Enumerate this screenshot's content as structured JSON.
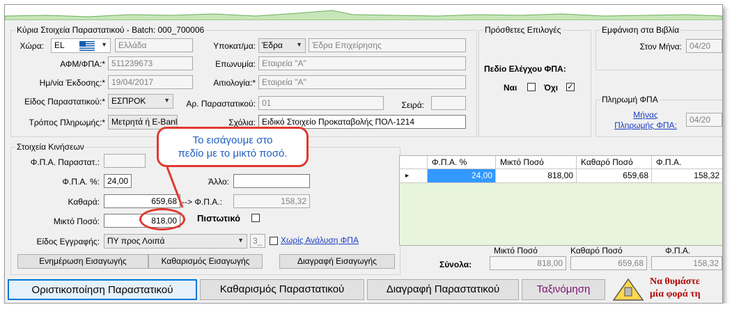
{
  "colors": {
    "accent_red": "#e03a2f",
    "callout_text": "#1f5fc0",
    "link": "#1a3dc1",
    "grid_selected": "#3399ff",
    "grid_background": "#e8f5dc",
    "warning_text": "#b40000",
    "sort_button_text": "#7a1070"
  },
  "main_group": {
    "title": "Κύρια Στοιχεία Παραστατικού - Batch: 000_700006",
    "country_label": "Χώρα:",
    "country_code": "EL",
    "country_name": "Ελλάδα",
    "afm_label": "ΑΦΜ/ΦΠΑ:*",
    "afm_value": "511239673",
    "date_label": "Ημ/νία Έκδοσης:*",
    "date_value": "19/04/2017",
    "doctype_label": "Είδος Παραστατικού:*",
    "doctype_value": "ΕΣΠΡΟΚ",
    "payment_label": "Τρόπος Πληρωμής:*",
    "payment_value": "Μετρητά ή E-Banl",
    "branch_label": "Υποκατ/μα:",
    "branch_value": "Έδρα",
    "branch_desc": "Έδρα Επιχείρησης",
    "name_label": "Επωνυμία:",
    "name_value": "Εταιρεία \"Α\"",
    "reason_label": "Αιτιολογία:*",
    "reason_value": "Εταιρεία \"Α\"",
    "docnum_label": "Αρ. Παραστατικού:",
    "docnum_value": "01",
    "series_label": "Σειρά:",
    "comments_label": "Σχόλια:",
    "comments_value": "Ειδικό Στοιχείο Προκαταβολής ΠΟΛ-1214"
  },
  "options_group": {
    "title": "Πρόσθετες Επιλογές",
    "vat_check_label": "Πεδίο Ελέγχου ΦΠΑ:",
    "yes_label": "Ναι",
    "no_label": "Όχι",
    "yes_checked": false,
    "no_checked": true
  },
  "books_group": {
    "title": "Εμφάνιση στα Βιβλία",
    "month_label": "Στον Μήνα:",
    "month_value": "04/20"
  },
  "vat_payment_group": {
    "title": "Πληρωμή ΦΠΑ",
    "link_line1": "Μήνας",
    "link_line2": "Πληρωμής ΦΠΑ:",
    "value": "04/20"
  },
  "movements_group": {
    "title": "Στοιχεία Κινήσεων",
    "vat_doc_label": "Φ.Π.Α. Παραστατ.:",
    "vat_pct_label": "Φ.Π.Α. %:",
    "vat_pct_value": "24,00",
    "net_label": "Καθαρά:",
    "net_value": "659,68",
    "vat_arrow_label": "--> Φ.Π.Α.:",
    "vat_amount": "158,32",
    "other_label": "Άλλο:",
    "gross_label": "Μικτό Ποσό:",
    "gross_value": "818,00",
    "credit_label": "Πιστωτικό",
    "entry_type_label": "Είδος Εγγραφής:",
    "entry_type_value": "ΠΥ προς Λοιπά",
    "entry_type_code": "3_",
    "no_vat_label": "Χωρίς Ανάλυση ΦΠΑ"
  },
  "callout": {
    "line1": "Το εισάγουμε στο",
    "line2": "πεδίο με το μικτό ποσό."
  },
  "grid": {
    "columns": [
      "Φ.Π.Α. %",
      "Μικτό Ποσό",
      "Καθαρό Ποσό",
      "Φ.Π.Α."
    ],
    "rows": [
      [
        "24,00",
        "818,00",
        "659,68",
        "158,32"
      ]
    ],
    "row_indicator": "▸"
  },
  "entry_buttons": {
    "update": "Ενημέρωση Εισαγωγής",
    "clear": "Καθαρισμός Εισαγωγής",
    "delete": "Διαγραφή Εισαγωγής"
  },
  "totals": {
    "label": "Σύνολα:",
    "gross_header": "Μικτό Ποσό",
    "net_header": "Καθαρό Ποσό",
    "vat_header": "Φ.Π.Α.",
    "gross_value": "818,00",
    "net_value": "659,68",
    "vat_value": "158,32"
  },
  "bottom_buttons": {
    "finalize": "Οριστικοποίηση Παραστατικού",
    "clear": "Καθαρισμός Παραστατικού",
    "delete": "Διαγραφή Παραστατικού",
    "sort": "Ταξινόμηση"
  },
  "warning": {
    "line1": "Να θυμάστε",
    "line2": "μία φορά τη"
  }
}
